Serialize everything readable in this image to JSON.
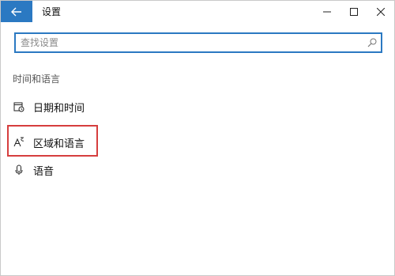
{
  "window": {
    "title": "设置",
    "accent_color": "#2b79c2"
  },
  "titlebar": {
    "back_icon": "arrow-left-icon",
    "controls": {
      "minimize_icon": "minimize-icon",
      "maximize_icon": "maximize-icon",
      "close_icon": "close-icon"
    }
  },
  "search": {
    "placeholder": "查找设置",
    "value": "",
    "icon": "search-icon"
  },
  "section": {
    "title": "时间和语言"
  },
  "nav": {
    "items": [
      {
        "label": "日期和时间",
        "icon": "calendar-clock-icon"
      },
      {
        "label": "区域和语言",
        "icon": "region-language-icon",
        "highlighted": true,
        "highlight_color": "#d63e3e"
      },
      {
        "label": "语音",
        "icon": "microphone-icon"
      }
    ]
  }
}
